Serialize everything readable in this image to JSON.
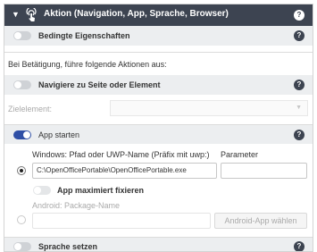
{
  "header": {
    "title": "Aktion (Navigation, App, Sprache, Browser)",
    "caret_icon": "caret-down-icon",
    "action_icon": "touch-pointer-icon",
    "help_label": "?"
  },
  "conditions": {
    "toggle_state": "off",
    "label": "Bedingte Eigenschaften",
    "help_label": "?"
  },
  "intro_text": "Bei Betätigung, führe folgende Aktionen aus:",
  "navigate": {
    "toggle_state": "off",
    "label": "Navigiere zu Seite oder Element",
    "help_label": "?",
    "target_label": "Zielelement:"
  },
  "app_start": {
    "toggle_state": "on",
    "label": "App starten",
    "help_label": "?",
    "windows_label": "Windows: Pfad oder UWP-Name (Präfix mit uwp:)",
    "windows_path_value": "C:\\OpenOfficePortable\\OpenOfficePortable.exe",
    "parameter_label": "Parameter",
    "parameter_value": "",
    "maximize_toggle_state": "off",
    "maximize_label": "App maximiert fixieren",
    "android_label": "Android: Package-Name",
    "android_value": "",
    "android_button_label": "Android-App wählen"
  },
  "language": {
    "toggle_state": "off",
    "label": "Sprache setzen",
    "help_label": "?"
  },
  "colors": {
    "header_bg": "#3d4451",
    "toggle_on": "#2f4fa6",
    "section_bg": "#eceef0"
  }
}
